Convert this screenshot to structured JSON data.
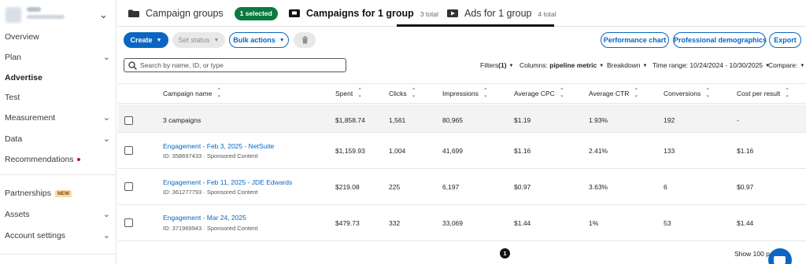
{
  "sidebar": {
    "account_chevron": "⌄",
    "items": [
      {
        "label": "Overview",
        "chevron": ""
      },
      {
        "label": "Plan",
        "chevron": "⌄"
      },
      {
        "label": "Advertise",
        "chevron": ""
      },
      {
        "label": "Test",
        "chevron": ""
      },
      {
        "label": "Measurement",
        "chevron": "⌄"
      },
      {
        "label": "Data",
        "chevron": "⌄"
      },
      {
        "label": "Recommendations",
        "chevron": ""
      },
      {
        "label": "Partnerships",
        "chevron": "",
        "badge": "NEW"
      },
      {
        "label": "Assets",
        "chevron": "⌄"
      },
      {
        "label": "Account settings",
        "chevron": "⌄"
      }
    ],
    "active_item": "Advertise"
  },
  "tabs": [
    {
      "label": "Campaign groups",
      "icon": "folder-icon",
      "pill": "1 selected"
    },
    {
      "label": "Campaigns for 1 group",
      "icon": "campaign-icon",
      "count": "3 total",
      "active": true
    },
    {
      "label": "Ads for 1 group",
      "icon": "ad-icon",
      "count": "4 total"
    }
  ],
  "toolbar": {
    "create": "Create",
    "set_status": "Set status",
    "bulk_actions": "Bulk actions",
    "performance_chart": "Performance chart",
    "professional_demographics": "Professional demographics",
    "export": "Export"
  },
  "filters": {
    "search_placeholder": "Search by name, ID, or type",
    "filters_label": "Filters",
    "filters_count": "(1)",
    "columns_label": "Columns:",
    "columns_value": "pipeline metric",
    "breakdown": "Breakdown",
    "time_range": "Time range: 10/24/2024 - 10/30/2025",
    "compare": "Compare:"
  },
  "table": {
    "columns": [
      "Campaign name",
      "Spent",
      "Clicks",
      "Impressions",
      "Average CPC",
      "Average CTR",
      "Conversions",
      "Cost per result"
    ],
    "total_row": {
      "name": "3 campaigns",
      "spent": "$1,858.74",
      "clicks": "1,561",
      "impressions": "80,965",
      "cpc": "$1.19",
      "ctr": "1.93%",
      "conversions": "192",
      "cost": "-"
    },
    "rows": [
      {
        "name": "Engagement - Feb 3, 2025 - NetSuite",
        "sub": "ID: 358697433 · Sponsored Content",
        "spent": "$1,159.93",
        "clicks": "1,004",
        "impressions": "41,699",
        "cpc": "$1.16",
        "ctr": "2.41%",
        "conversions": "133",
        "cost": "$1.16"
      },
      {
        "name": "Engagement - Feb 11, 2025 - JDE Edwards",
        "sub": "ID: 361277793 · Sponsored Content",
        "spent": "$219.08",
        "clicks": "225",
        "impressions": "6,197",
        "cpc": "$0.97",
        "ctr": "3.63%",
        "conversions": "6",
        "cost": "$0.97"
      },
      {
        "name": "Engagement - Mar 24, 2025",
        "sub": "ID: 371969943 · Sponsored Content",
        "spent": "$479.73",
        "clicks": "332",
        "impressions": "33,069",
        "cpc": "$1.44",
        "ctr": "1%",
        "conversions": "53",
        "cost": "$1.44"
      }
    ]
  },
  "footer": {
    "page": "1",
    "show_per_page": "Show 100 pe"
  },
  "colors": {
    "brand": "#0a66c2",
    "selected_pill": "#0b7a3f",
    "notification": "#cc1016"
  }
}
